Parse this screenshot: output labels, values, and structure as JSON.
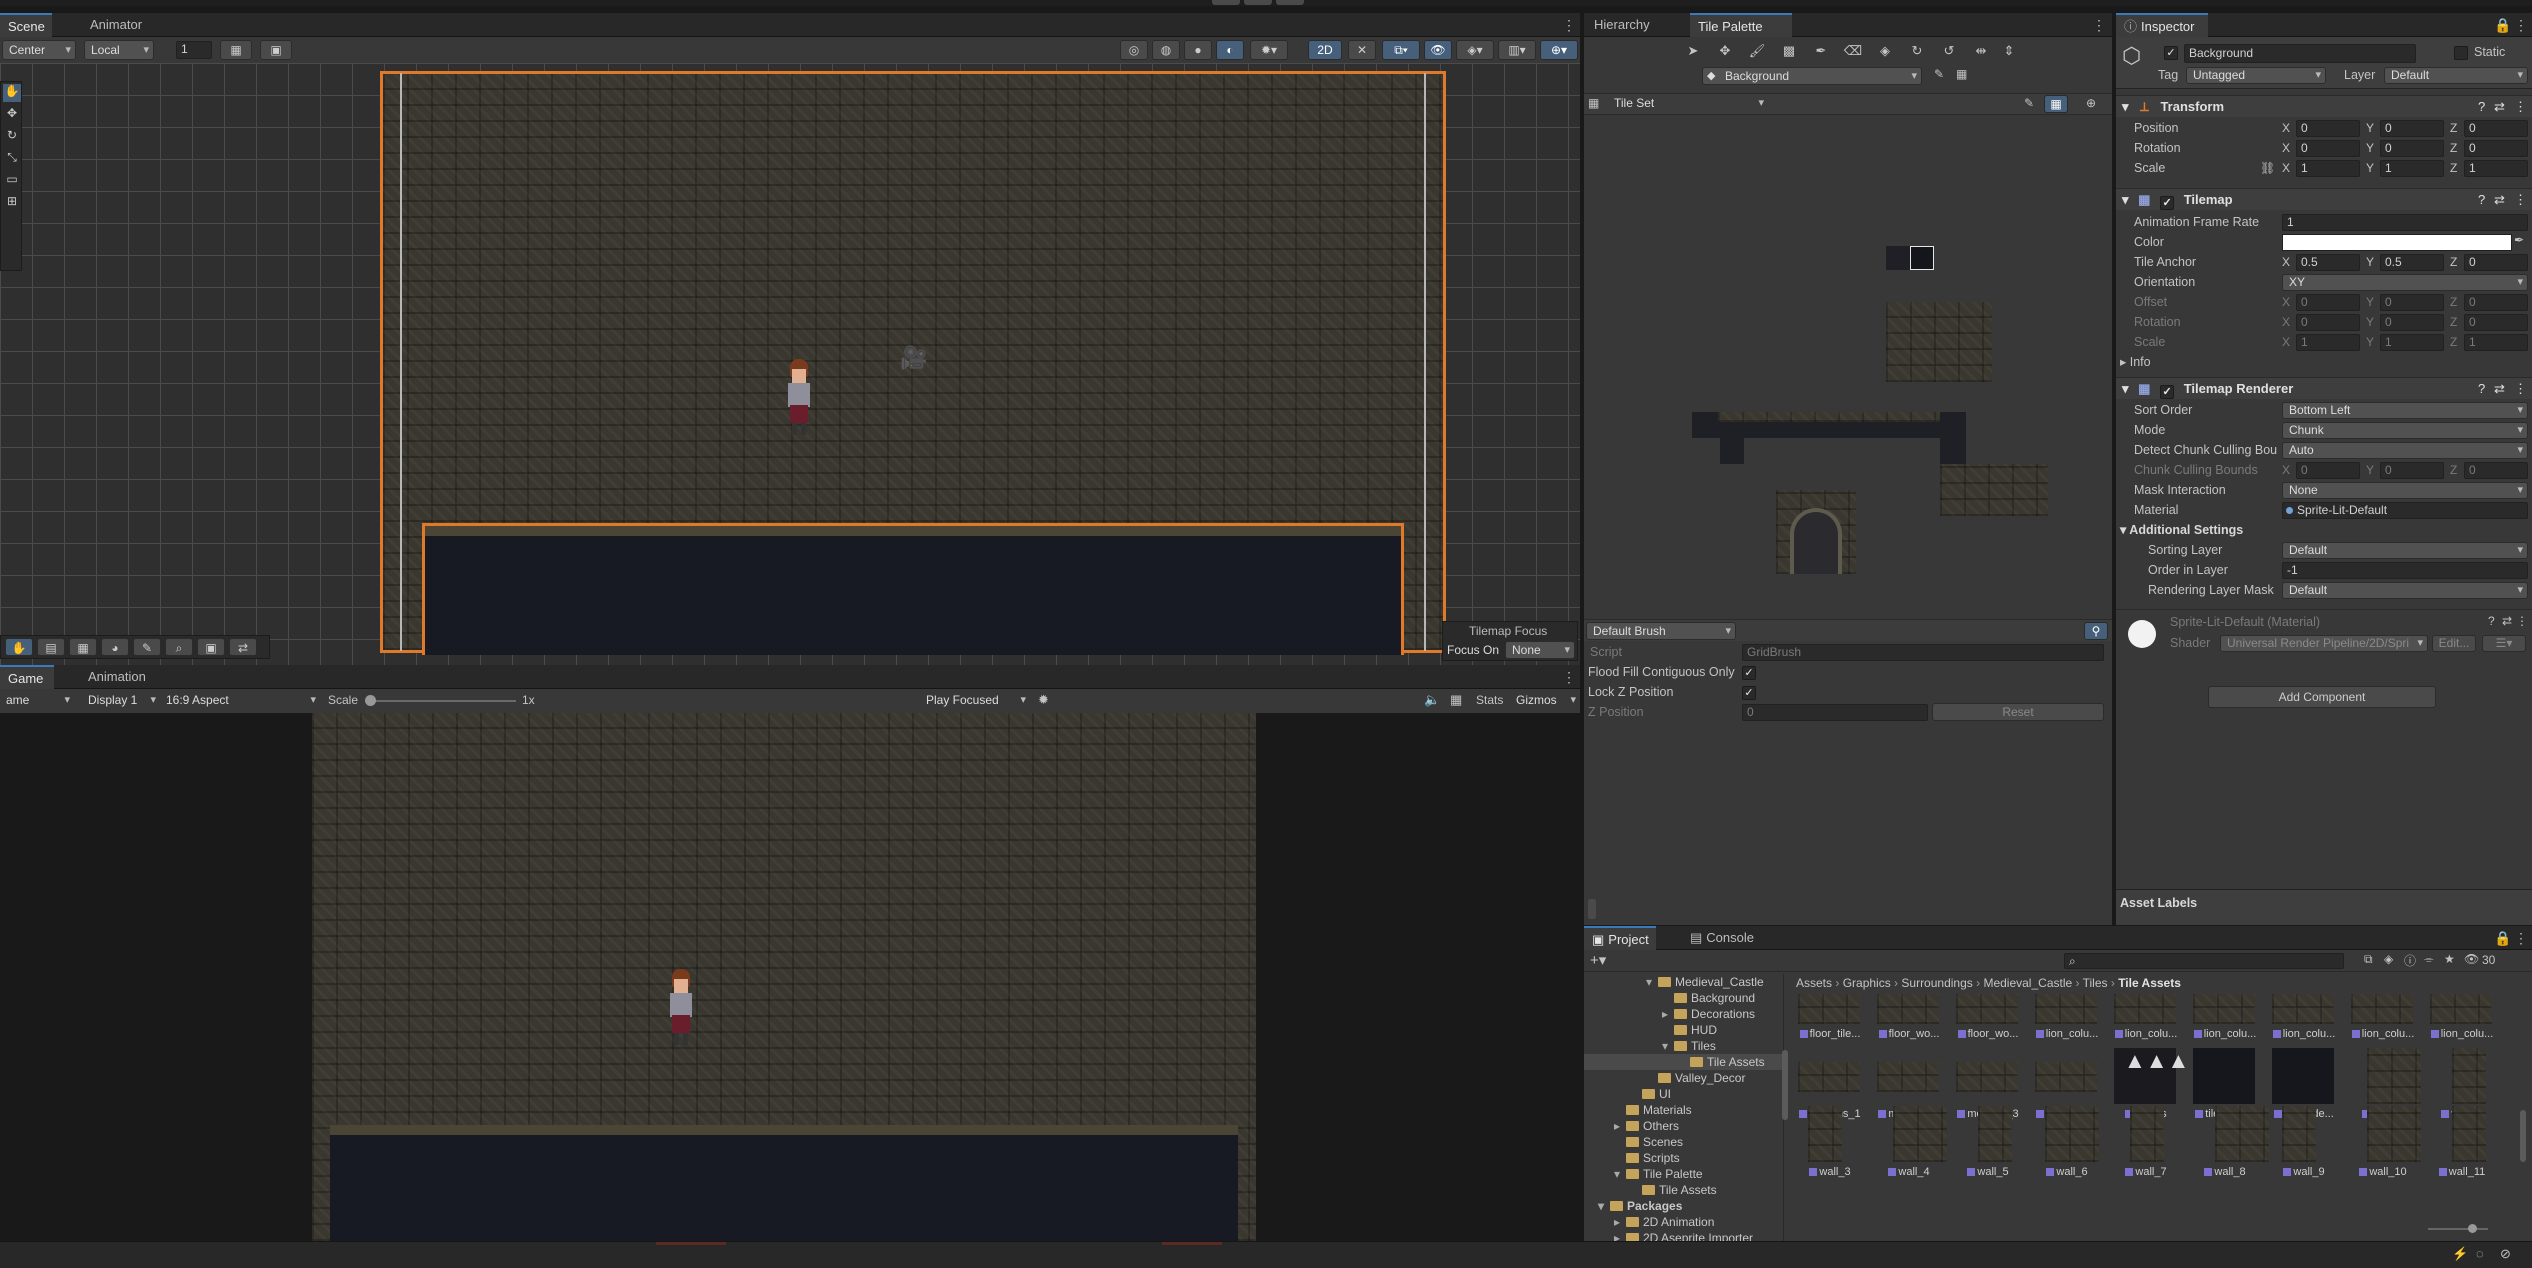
{
  "scene": {
    "tabs": [
      {
        "label": "Scene",
        "active": true
      },
      {
        "label": "Animator",
        "active": false
      }
    ],
    "toolbar": {
      "pivot": "Center",
      "space": "Local",
      "snap": "1",
      "mode2d": "2D"
    },
    "tools": [
      "hand-tool-icon",
      "move-tool-icon",
      "rotate-tool-icon",
      "scale-tool-icon",
      "rect-tool-icon",
      "transform-tool-icon"
    ],
    "overlay": {
      "title": "Tilemap Focus",
      "focus_label": "Focus On",
      "focus_value": "None"
    }
  },
  "game": {
    "tabs": [
      {
        "label": "Game",
        "active": true
      },
      {
        "label": "Animation",
        "active": false
      }
    ],
    "toolbar": {
      "mode": "ame",
      "display": "Display 1",
      "aspect": "16:9 Aspect",
      "scale_label": "Scale",
      "scale_value": "1x",
      "play_mode": "Play Focused",
      "stats": "Stats",
      "gizmos": "Gizmos"
    }
  },
  "hierarchy": {
    "tabs": [
      {
        "label": "Hierarchy",
        "active": false
      },
      {
        "label": "Tile Palette",
        "active": true
      }
    ],
    "active_tilemap": "Background",
    "palette": "Tile Set",
    "brush": "Default Brush",
    "brush_props": {
      "script_label": "Script",
      "script_value": "GridBrush",
      "flood_label": "Flood Fill Contiguous Only",
      "lockz_label": "Lock Z Position",
      "zpos_label": "Z Position",
      "zpos_value": "0",
      "reset": "Reset"
    }
  },
  "inspector": {
    "tab": "Inspector",
    "object_name": "Background",
    "static_label": "Static",
    "tag_label": "Tag",
    "tag_value": "Untagged",
    "layer_label": "Layer",
    "layer_value": "Default",
    "transform": {
      "title": "Transform",
      "position_label": "Position",
      "position": {
        "x": "0",
        "y": "0",
        "z": "0"
      },
      "rotation_label": "Rotation",
      "rotation": {
        "x": "0",
        "y": "0",
        "z": "0"
      },
      "scale_label": "Scale",
      "scale": {
        "x": "1",
        "y": "1",
        "z": "1"
      }
    },
    "tilemap": {
      "title": "Tilemap",
      "frame_rate_label": "Animation Frame Rate",
      "frame_rate": "1",
      "color_label": "Color",
      "anchor_label": "Tile Anchor",
      "anchor": {
        "x": "0.5",
        "y": "0.5",
        "z": "0"
      },
      "orientation_label": "Orientation",
      "orientation": "XY",
      "offset_label": "Offset",
      "offset": {
        "x": "0",
        "y": "0",
        "z": "0"
      },
      "rotation_label": "Rotation",
      "rotation": {
        "x": "0",
        "y": "0",
        "z": "0"
      },
      "scale_label": "Scale",
      "scale": {
        "x": "1",
        "y": "1",
        "z": "1"
      },
      "info_label": "Info"
    },
    "renderer": {
      "title": "Tilemap Renderer",
      "sort_order_label": "Sort Order",
      "sort_order": "Bottom Left",
      "mode_label": "Mode",
      "mode": "Chunk",
      "culling_label": "Detect Chunk Culling Bou",
      "culling": "Auto",
      "bounds_label": "Chunk Culling Bounds",
      "bounds": {
        "x": "0",
        "y": "0",
        "z": "0"
      },
      "mask_label": "Mask Interaction",
      "mask": "None",
      "material_label": "Material",
      "material": "Sprite-Lit-Default",
      "additional_label": "Additional Settings",
      "sorting_layer_label": "Sorting Layer",
      "sorting_layer": "Default",
      "order_label": "Order in Layer",
      "order": "-1",
      "rendering_mask_label": "Rendering Layer Mask",
      "rendering_mask": "Default"
    },
    "material_block": {
      "name": "Sprite-Lit-Default (Material)",
      "shader_label": "Shader",
      "shader": "Universal Render Pipeline/2D/Spri",
      "edit": "Edit..."
    },
    "add_component": "Add Component",
    "asset_labels": "Asset Labels"
  },
  "project": {
    "tabs": [
      {
        "label": "Project",
        "active": true
      },
      {
        "label": "Console",
        "active": false
      }
    ],
    "count": "30",
    "breadcrumb": [
      "Assets",
      "Graphics",
      "Surroundings",
      "Medieval_Castle",
      "Tiles",
      "Tile Assets"
    ],
    "tree": [
      {
        "label": "Medieval_Castle",
        "indent": 2,
        "arrow": "▾"
      },
      {
        "label": "Background",
        "indent": 3,
        "arrow": ""
      },
      {
        "label": "Decorations",
        "indent": 3,
        "arrow": "▸"
      },
      {
        "label": "HUD",
        "indent": 3,
        "arrow": ""
      },
      {
        "label": "Tiles",
        "indent": 3,
        "arrow": "▾"
      },
      {
        "label": "Tile Assets",
        "indent": 4,
        "arrow": "",
        "selected": true
      },
      {
        "label": "Valley_Decor",
        "indent": 2,
        "arrow": ""
      },
      {
        "label": "UI",
        "indent": 1,
        "arrow": ""
      },
      {
        "label": "Materials",
        "indent": 0,
        "arrow": ""
      },
      {
        "label": "Others",
        "indent": 0,
        "arrow": "▸"
      },
      {
        "label": "Scenes",
        "indent": 0,
        "arrow": ""
      },
      {
        "label": "Scripts",
        "indent": 0,
        "arrow": ""
      },
      {
        "label": "Tile Palette",
        "indent": 0,
        "arrow": "▾"
      },
      {
        "label": "Tile Assets",
        "indent": 1,
        "arrow": ""
      },
      {
        "label": "Packages",
        "indent": -1,
        "arrow": "▾",
        "bold": true
      },
      {
        "label": "2D Animation",
        "indent": 0,
        "arrow": "▸"
      },
      {
        "label": "2D Aseprite Importer",
        "indent": 0,
        "arrow": "▸"
      }
    ],
    "assets_row1": [
      "floor_tile...",
      "floor_wo...",
      "floor_wo...",
      "lion_colu...",
      "lion_colu...",
      "lion_colu...",
      "lion_colu...",
      "lion_colu...",
      "lion_colu..."
    ],
    "assets_row2": [
      "merlons_1",
      "merlons_2",
      "merlons_3",
      "merlons_4",
      "spikes",
      "tile_side...",
      "tile_side...",
      "wall_1",
      "wall_2"
    ],
    "assets_row3": [
      "wall_3",
      "wall_4",
      "wall_5",
      "wall_6",
      "wall_7",
      "wall_8",
      "wall_9",
      "wall_10",
      "wall_11"
    ]
  }
}
